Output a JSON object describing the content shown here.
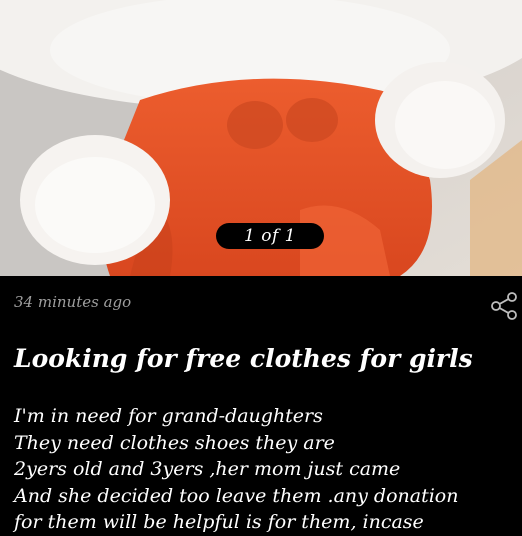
{
  "listing": {
    "pager": "1 of 1",
    "posted_time": "34 minutes ago",
    "title": "Looking for free clothes for girls",
    "description_lines": [
      "I'm in need for grand-daughters",
      "They need clothes shoes they are",
      "2yers old and 3yers ,her mom just came",
      "And she decided too leave them .any donation",
      "for them will be helpful is for them, incase"
    ]
  },
  "icons": {
    "share": "share-icon"
  },
  "colors": {
    "background": "#000000",
    "text": "#ffffff",
    "meta_text": "#9e9e9e",
    "dress_orange": "#e8552a"
  }
}
